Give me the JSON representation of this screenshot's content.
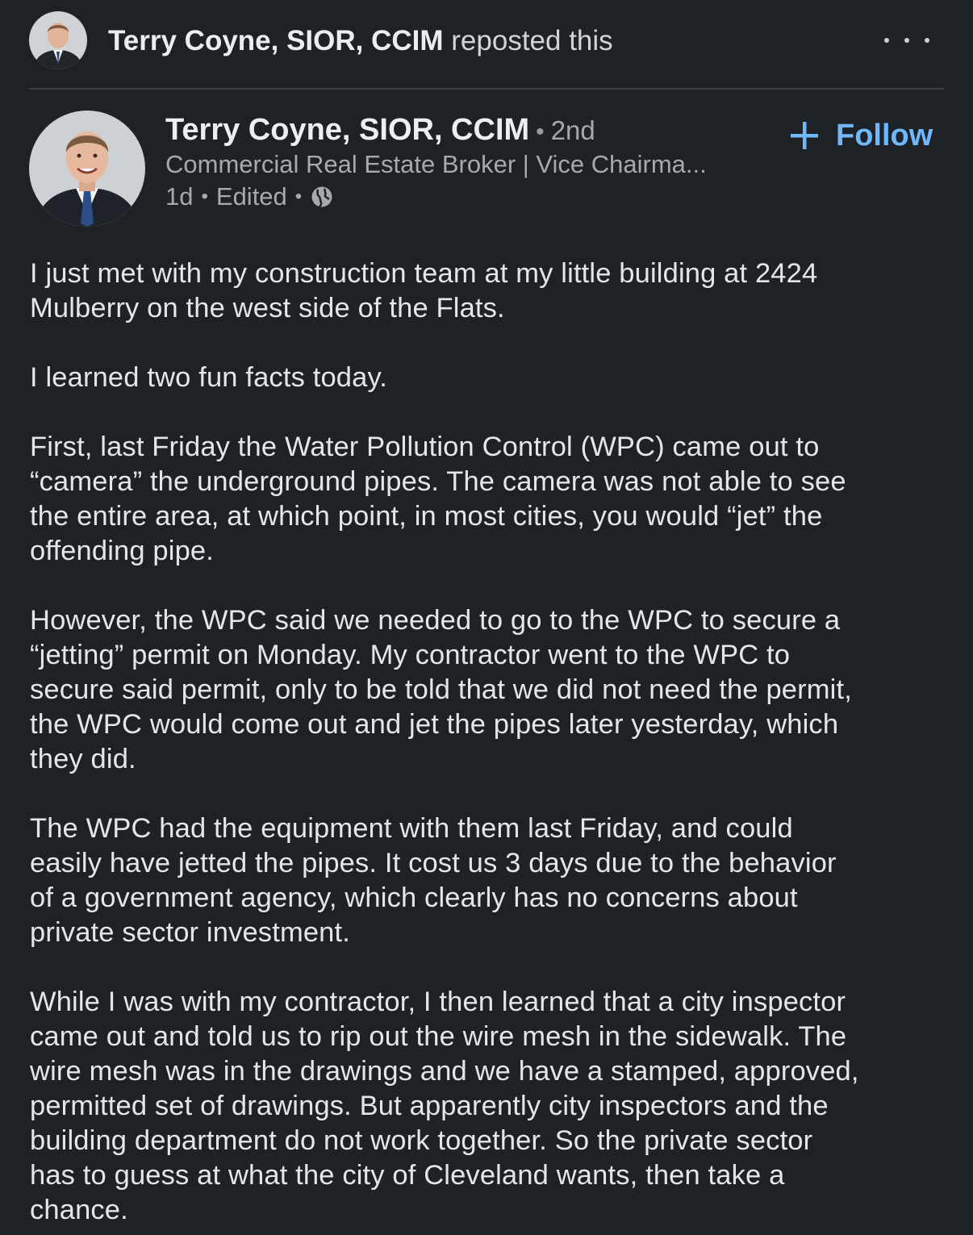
{
  "repost_header": {
    "actor_name": "Terry Coyne, SIOR, CCIM",
    "action_text": " reposted this",
    "more_icon": "more-horizontal-icon"
  },
  "post": {
    "author": {
      "name": "Terry Coyne, SIOR, CCIM",
      "separator": "•",
      "degree": "2nd",
      "headline": "Commercial Real Estate Broker | Vice Chairma...",
      "time": "1d",
      "edited": "Edited",
      "visibility_icon": "globe-icon"
    },
    "follow": {
      "label": "Follow",
      "icon": "plus-icon",
      "color": "#71b7fb"
    },
    "paragraphs": [
      "I just met with my construction team at my little building at 2424\nMulberry on the west side of the Flats.",
      "I learned two fun facts today.",
      "First, last Friday the Water Pollution Control (WPC) came out to\n“camera” the underground pipes.  The camera was not able to see\nthe entire area, at which point, in most cities, you would “jet” the\noffending pipe.",
      "However, the WPC said we needed to go to the WPC to secure a\n“jetting” permit on Monday.  My contractor went to the WPC to\nsecure said permit, only to be told that we did not need the permit,\nthe WPC would come out and jet the pipes later yesterday, which\nthey did.",
      "The WPC had the equipment with them last Friday, and could\neasily have jetted the pipes.  It cost us 3 days due to the behavior\nof a government agency, which clearly has no concerns about\nprivate sector investment.",
      "While I was with my contractor, I then learned that a city inspector\ncame out and told us to rip out the wire mesh in the sidewalk.  The\nwire mesh was in the drawings and we have a stamped, approved,\npermitted set of drawings.  But apparently city inspectors and the\nbuilding department do not work together.  So the private sector\nhas to guess at what the city of Cleveland wants, then take a\nchance."
    ]
  },
  "colors": {
    "background": "#1d2226",
    "divider": "#3b4045",
    "primary_text": "#e6e6e6",
    "secondary_text": "#a9a9a9",
    "accent": "#71b7fb"
  }
}
